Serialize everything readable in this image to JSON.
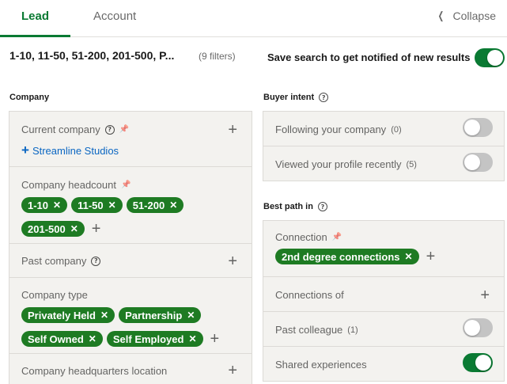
{
  "tabs": {
    "lead": "Lead",
    "account": "Account",
    "collapse": "Collapse"
  },
  "summary": {
    "text": "1-10, 11-50, 51-200, 201-500, P...",
    "filters_count": "(9 filters)",
    "save_label": "Save search to get notified of new results",
    "save_toggle_on": true
  },
  "company_section": {
    "title": "Company",
    "current_company": {
      "label": "Current company",
      "add_value": "Streamline Studios"
    },
    "headcount": {
      "label": "Company headcount",
      "pills": [
        "1-10",
        "11-50",
        "51-200",
        "201-500"
      ]
    },
    "past_company": {
      "label": "Past company"
    },
    "company_type": {
      "label": "Company type",
      "pills": [
        "Privately Held",
        "Partnership",
        "Self Owned",
        "Self Employed"
      ]
    },
    "hq_location": {
      "label": "Company headquarters location"
    }
  },
  "buyer_intent": {
    "title": "Buyer intent",
    "following": {
      "label": "Following your company",
      "count": "(0)",
      "on": false
    },
    "viewed": {
      "label": "Viewed your profile recently",
      "count": "(5)",
      "on": false
    }
  },
  "best_path": {
    "title": "Best path in",
    "connection": {
      "label": "Connection",
      "pills": [
        "2nd degree connections"
      ]
    },
    "connections_of": {
      "label": "Connections of"
    },
    "past_colleague": {
      "label": "Past colleague",
      "count": "(1)",
      "on": false
    },
    "shared_experiences": {
      "label": "Shared experiences",
      "on": true
    }
  },
  "colors": {
    "accent": "#0a7a33",
    "pill": "#1e7b23",
    "link": "#0a66c2"
  }
}
